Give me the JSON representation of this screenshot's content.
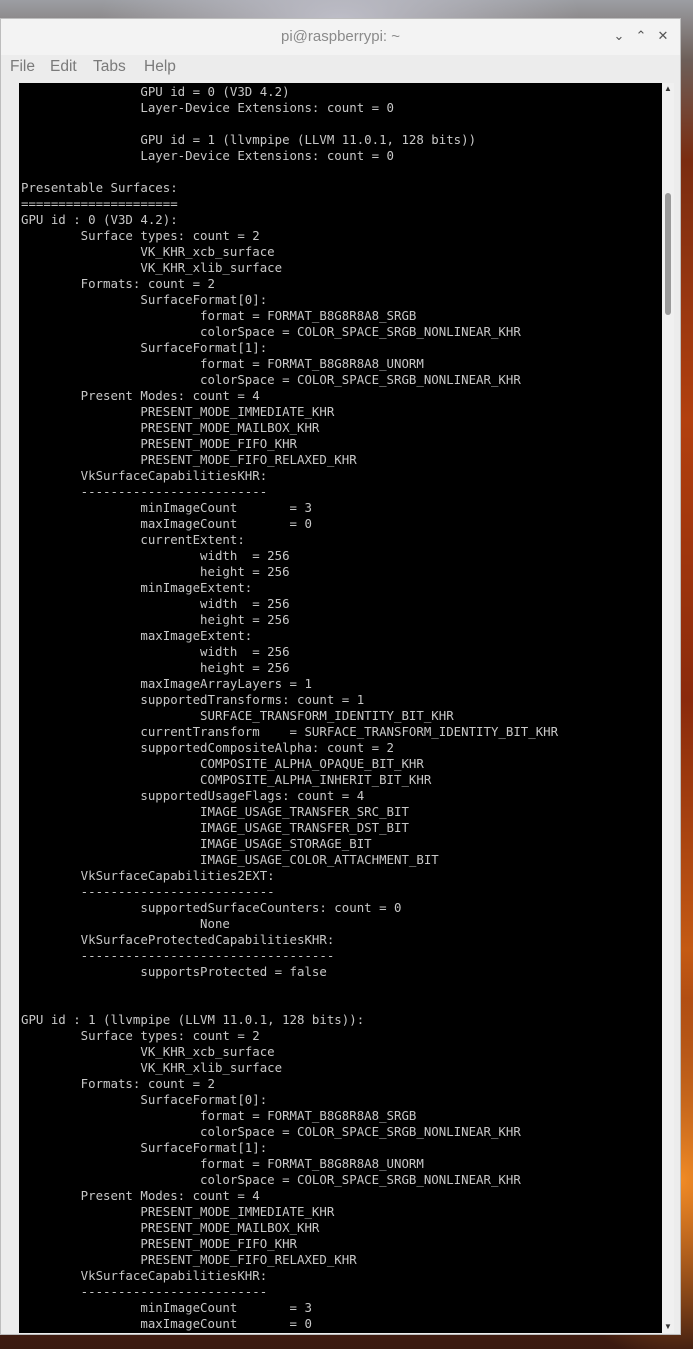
{
  "window": {
    "title": "pi@raspberrypi: ~",
    "minimize_icon": "chevron-down-icon",
    "maximize_icon": "chevron-up-icon",
    "close_icon": "close-icon",
    "minimize_glyph": "⌄",
    "maximize_glyph": "⌃",
    "close_glyph": "✕"
  },
  "menubar": {
    "file": "File",
    "edit": "Edit",
    "tabs": "Tabs",
    "help": "Help"
  },
  "scrollbar": {
    "up_glyph": "▲",
    "down_glyph": "▼"
  },
  "terminal": {
    "lines": [
      "                GPU id = 0 (V3D 4.2)",
      "                Layer-Device Extensions: count = 0",
      "",
      "                GPU id = 1 (llvmpipe (LLVM 11.0.1, 128 bits))",
      "                Layer-Device Extensions: count = 0",
      "",
      "Presentable Surfaces:",
      "=====================",
      "GPU id : 0 (V3D 4.2):",
      "        Surface types: count = 2",
      "                VK_KHR_xcb_surface",
      "                VK_KHR_xlib_surface",
      "        Formats: count = 2",
      "                SurfaceFormat[0]:",
      "                        format = FORMAT_B8G8R8A8_SRGB",
      "                        colorSpace = COLOR_SPACE_SRGB_NONLINEAR_KHR",
      "                SurfaceFormat[1]:",
      "                        format = FORMAT_B8G8R8A8_UNORM",
      "                        colorSpace = COLOR_SPACE_SRGB_NONLINEAR_KHR",
      "        Present Modes: count = 4",
      "                PRESENT_MODE_IMMEDIATE_KHR",
      "                PRESENT_MODE_MAILBOX_KHR",
      "                PRESENT_MODE_FIFO_KHR",
      "                PRESENT_MODE_FIFO_RELAXED_KHR",
      "        VkSurfaceCapabilitiesKHR:",
      "        -------------------------",
      "                minImageCount       = 3",
      "                maxImageCount       = 0",
      "                currentExtent:",
      "                        width  = 256",
      "                        height = 256",
      "                minImageExtent:",
      "                        width  = 256",
      "                        height = 256",
      "                maxImageExtent:",
      "                        width  = 256",
      "                        height = 256",
      "                maxImageArrayLayers = 1",
      "                supportedTransforms: count = 1",
      "                        SURFACE_TRANSFORM_IDENTITY_BIT_KHR",
      "                currentTransform    = SURFACE_TRANSFORM_IDENTITY_BIT_KHR",
      "                supportedCompositeAlpha: count = 2",
      "                        COMPOSITE_ALPHA_OPAQUE_BIT_KHR",
      "                        COMPOSITE_ALPHA_INHERIT_BIT_KHR",
      "                supportedUsageFlags: count = 4",
      "                        IMAGE_USAGE_TRANSFER_SRC_BIT",
      "                        IMAGE_USAGE_TRANSFER_DST_BIT",
      "                        IMAGE_USAGE_STORAGE_BIT",
      "                        IMAGE_USAGE_COLOR_ATTACHMENT_BIT",
      "        VkSurfaceCapabilities2EXT:",
      "        --------------------------",
      "                supportedSurfaceCounters: count = 0",
      "                        None",
      "        VkSurfaceProtectedCapabilitiesKHR:",
      "        ----------------------------------",
      "                supportsProtected = false",
      "",
      "",
      "GPU id : 1 (llvmpipe (LLVM 11.0.1, 128 bits)):",
      "        Surface types: count = 2",
      "                VK_KHR_xcb_surface",
      "                VK_KHR_xlib_surface",
      "        Formats: count = 2",
      "                SurfaceFormat[0]:",
      "                        format = FORMAT_B8G8R8A8_SRGB",
      "                        colorSpace = COLOR_SPACE_SRGB_NONLINEAR_KHR",
      "                SurfaceFormat[1]:",
      "                        format = FORMAT_B8G8R8A8_UNORM",
      "                        colorSpace = COLOR_SPACE_SRGB_NONLINEAR_KHR",
      "        Present Modes: count = 4",
      "                PRESENT_MODE_IMMEDIATE_KHR",
      "                PRESENT_MODE_MAILBOX_KHR",
      "                PRESENT_MODE_FIFO_KHR",
      "                PRESENT_MODE_FIFO_RELAXED_KHR",
      "        VkSurfaceCapabilitiesKHR:",
      "        -------------------------",
      "                minImageCount       = 3",
      "                maxImageCount       = 0"
    ]
  }
}
